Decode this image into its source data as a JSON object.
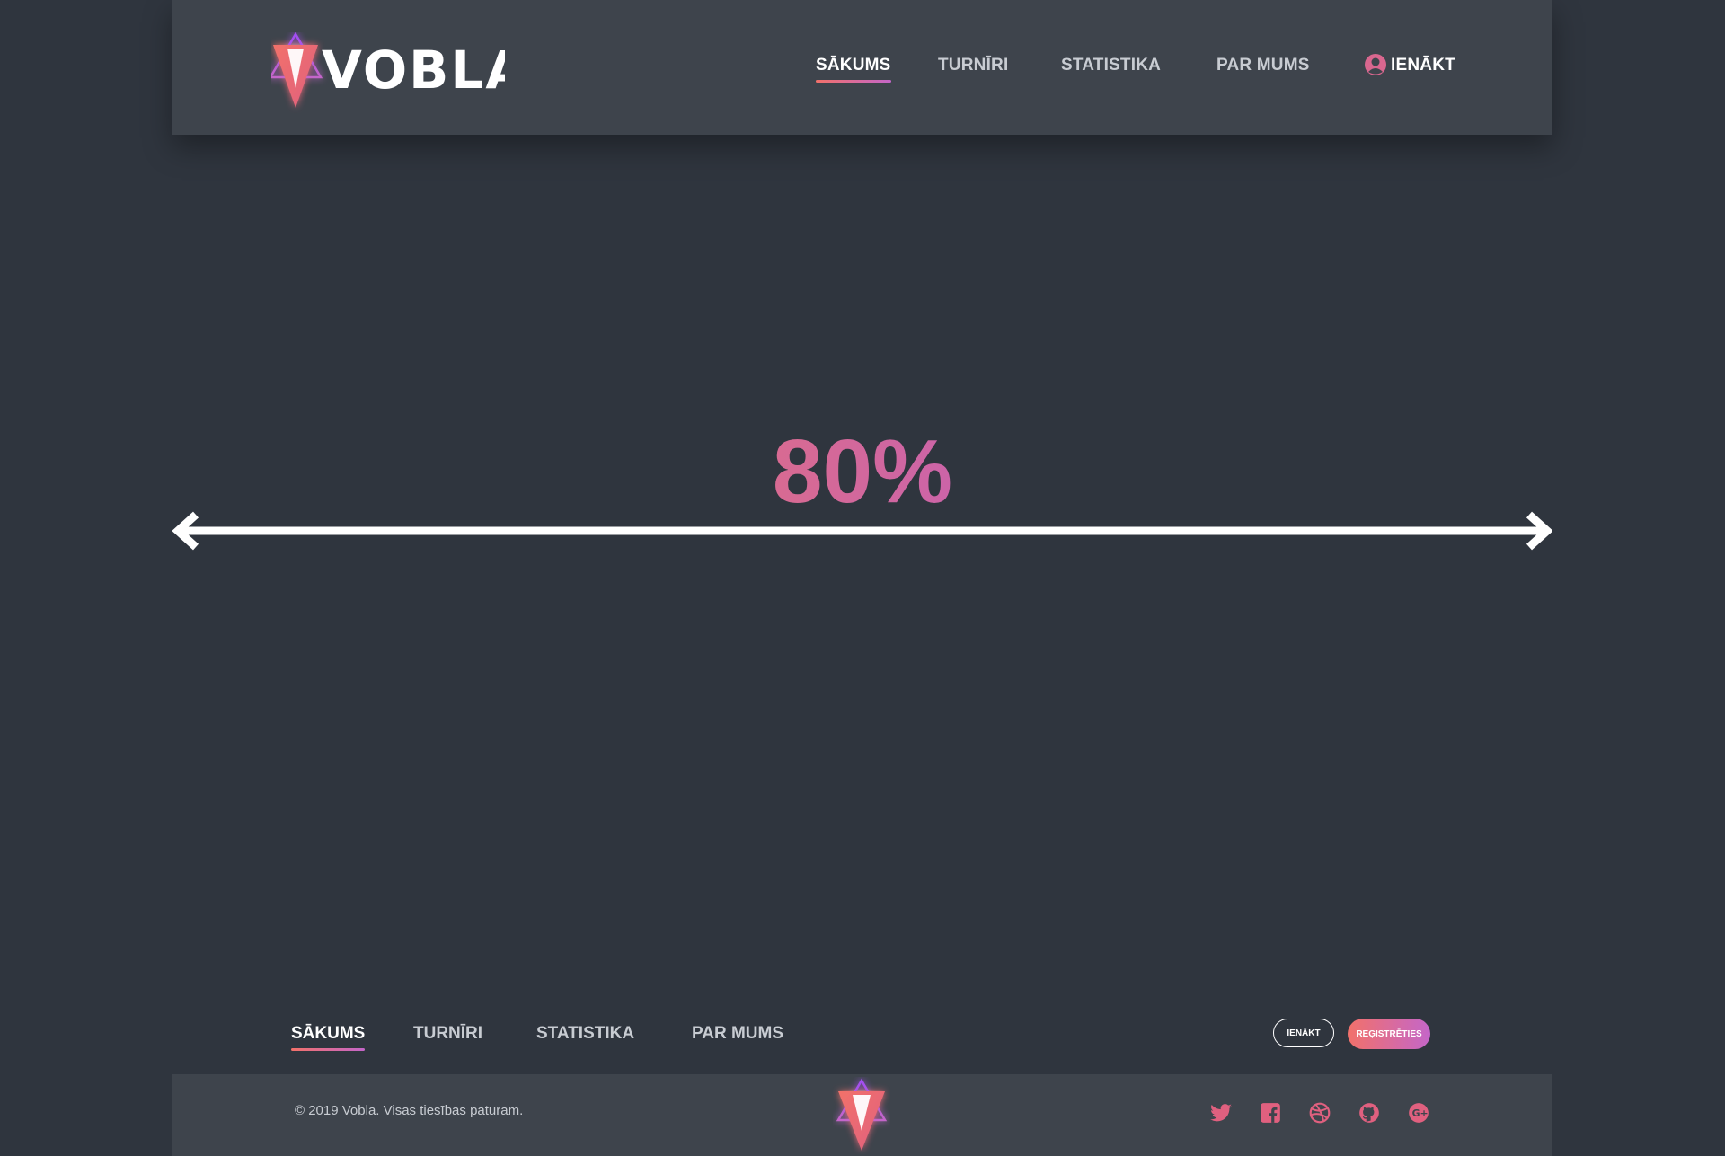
{
  "header": {
    "brand": "VOBLA",
    "nav": [
      {
        "label": "SĀKUMS",
        "active": true
      },
      {
        "label": "TURNĪRI",
        "active": false
      },
      {
        "label": "STATISTIKA",
        "active": false
      },
      {
        "label": "PAR MUMS",
        "active": false
      }
    ],
    "login_label": "IENĀKT"
  },
  "main": {
    "percent_label": "80%"
  },
  "footer": {
    "nav": [
      {
        "label": "SĀKUMS",
        "active": true
      },
      {
        "label": "TURNĪRI",
        "active": false
      },
      {
        "label": "STATISTIKA",
        "active": false
      },
      {
        "label": "PAR MUMS",
        "active": false
      }
    ],
    "login_button": "IENĀKT",
    "register_button": "REĢISTRĒTIES",
    "copyright": "© 2019 Vobla. Visas tiesības paturam.",
    "social_icons": [
      "twitter-icon",
      "facebook-icon",
      "dribbble-icon",
      "github-icon",
      "google-plus-icon"
    ]
  },
  "colors": {
    "background": "#2f353e",
    "panel": "#3e444c",
    "accent_start": "#f2716a",
    "accent_end": "#a24ef3"
  }
}
